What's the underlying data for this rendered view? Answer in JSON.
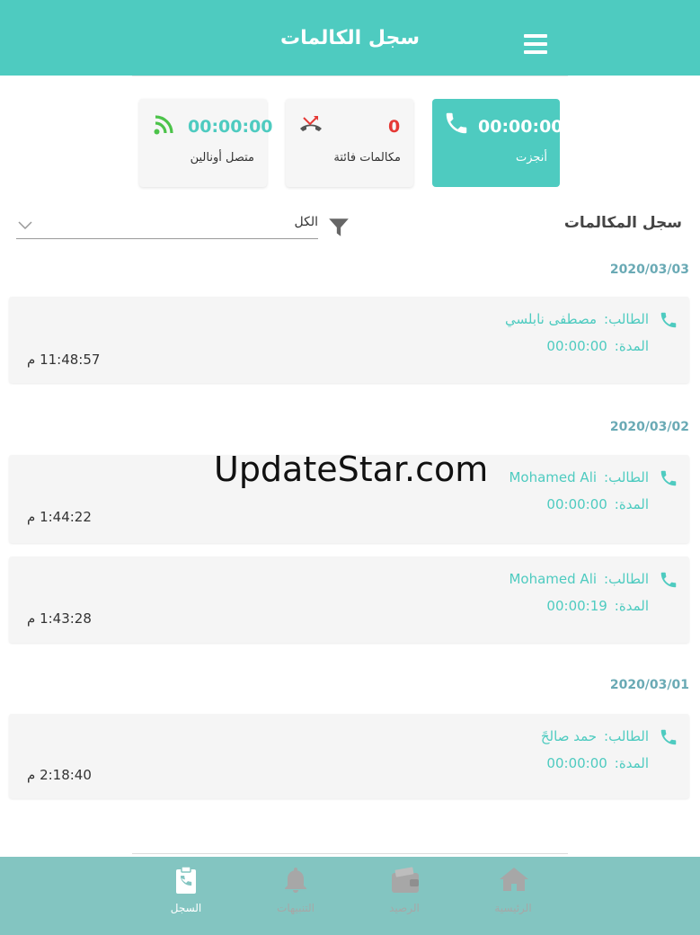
{
  "header": {
    "title": "سجل الكالمات"
  },
  "stats": {
    "completed": {
      "value": "00:00:00",
      "label": "أنجزت"
    },
    "missed": {
      "value": "0",
      "label": "مكالمات فائتة"
    },
    "online": {
      "value": "00:00:00",
      "label": "متصل أونالين"
    }
  },
  "filter": {
    "section_title": "سجل المكالمات",
    "selected": "الكل"
  },
  "groups": [
    {
      "date": "2020/03/03",
      "calls": [
        {
          "student_label": "الطالب:",
          "student": "مصطفى نابلسي",
          "duration_label": "المدة:",
          "duration": "00:00:00",
          "time": "11:48:57 م"
        }
      ]
    },
    {
      "date": "2020/03/02",
      "calls": [
        {
          "student_label": "الطالب:",
          "student": "Mohamed Ali",
          "duration_label": "المدة:",
          "duration": "00:00:00",
          "time": "1:44:22 م"
        },
        {
          "student_label": "الطالب:",
          "student": "Mohamed Ali",
          "duration_label": "المدة:",
          "duration": "00:00:19",
          "time": "1:43:28 م"
        }
      ]
    },
    {
      "date": "2020/03/01",
      "calls": [
        {
          "student_label": "الطالب:",
          "student": "حمد صالحً",
          "duration_label": "المدة:",
          "duration": "00:00:00",
          "time": "2:18:40 م"
        }
      ]
    }
  ],
  "watermark": "UpdateStar.com",
  "nav": {
    "home": "الرئيسية",
    "balance": "الرصيد",
    "notifications": "التنبيهات",
    "log": "السجل"
  },
  "colors": {
    "accent": "#4ecbc0",
    "missed": "#e53935",
    "online": "#4cc34a",
    "nav_bg": "#83c5c1",
    "date": "#6aaab5"
  }
}
